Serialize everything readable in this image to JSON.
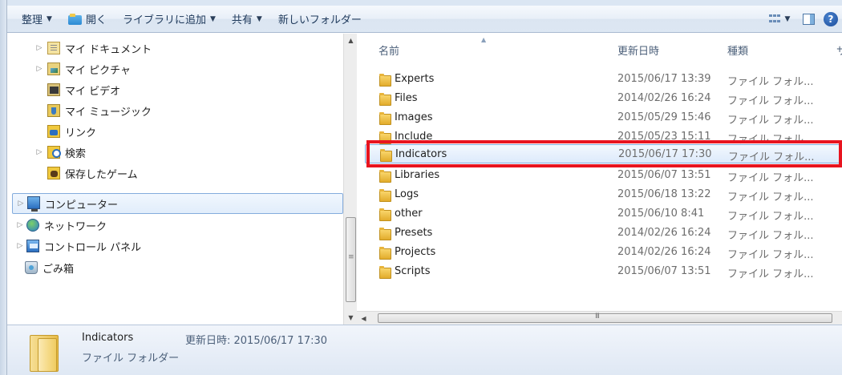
{
  "toolbar": {
    "organize": "整理",
    "open": "開く",
    "add_to_library": "ライブラリに追加",
    "share": "共有",
    "new_folder": "新しいフォルダー",
    "help": "?"
  },
  "nav": {
    "items": [
      {
        "label": "マイ ドキュメント",
        "icon": "documents-icon"
      },
      {
        "label": "マイ ピクチャ",
        "icon": "pictures-icon"
      },
      {
        "label": "マイ ビデオ",
        "icon": "videos-icon"
      },
      {
        "label": "マイ ミュージック",
        "icon": "music-icon"
      },
      {
        "label": "リンク",
        "icon": "links-icon"
      },
      {
        "label": "検索",
        "icon": "searches-icon"
      },
      {
        "label": "保存したゲーム",
        "icon": "saved-games-icon"
      },
      {
        "label": "コンピューター",
        "icon": "computer-icon",
        "selected": true
      },
      {
        "label": "ネットワーク",
        "icon": "network-icon"
      },
      {
        "label": "コントロール パネル",
        "icon": "control-panel-icon"
      },
      {
        "label": "ごみ箱",
        "icon": "recycle-bin-icon"
      }
    ]
  },
  "columns": {
    "name": "名前",
    "modified": "更新日時",
    "type": "種類",
    "size_partial": "サ"
  },
  "files": [
    {
      "name": "Experts",
      "modified": "2015/06/17 13:39",
      "type": "ファイル フォル..."
    },
    {
      "name": "Files",
      "modified": "2014/02/26 16:24",
      "type": "ファイル フォル..."
    },
    {
      "name": "Images",
      "modified": "2015/05/29 15:46",
      "type": "ファイル フォル..."
    },
    {
      "name": "Include",
      "modified": "2015/05/23 15:11",
      "type": "ファイル フォル..."
    },
    {
      "name": "Indicators",
      "modified": "2015/06/17 17:30",
      "type": "ファイル フォル...",
      "selected": true
    },
    {
      "name": "Libraries",
      "modified": "2015/06/07 13:51",
      "type": "ファイル フォル..."
    },
    {
      "name": "Logs",
      "modified": "2015/06/18 13:22",
      "type": "ファイル フォル..."
    },
    {
      "name": "other",
      "modified": "2015/06/10 8:41",
      "type": "ファイル フォル..."
    },
    {
      "name": "Presets",
      "modified": "2014/02/26 16:24",
      "type": "ファイル フォル..."
    },
    {
      "name": "Projects",
      "modified": "2014/02/26 16:24",
      "type": "ファイル フォル..."
    },
    {
      "name": "Scripts",
      "modified": "2015/06/07 13:51",
      "type": "ファイル フォル..."
    }
  ],
  "details": {
    "name": "Indicators",
    "modified": "更新日時: 2015/06/17 17:30",
    "type": "ファイル フォルダー"
  },
  "colors": {
    "highlight": "#e8141f",
    "selection_border": "#84acdd",
    "toolbar_text": "#1e395b"
  }
}
